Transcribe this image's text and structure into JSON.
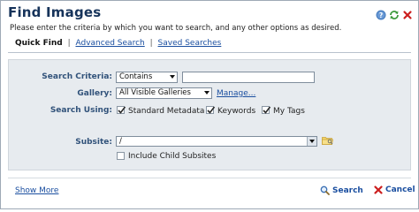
{
  "dialog": {
    "title": "Find Images",
    "instructions": "Please enter the criteria by which you want to search, and any other options as desired."
  },
  "header_icons": [
    "help-icon",
    "refresh-icon",
    "close-icon"
  ],
  "tabs": {
    "quick_find": "Quick Find",
    "advanced_search": "Advanced Search",
    "saved_searches": "Saved Searches",
    "separator": "|"
  },
  "form": {
    "search_criteria_label": "Search Criteria:",
    "criteria_operator": "Contains",
    "criteria_text": "",
    "gallery_label": "Gallery:",
    "gallery_value": "All Visible Galleries",
    "manage_link": "Manage...",
    "search_using_label": "Search Using:",
    "search_using_options": [
      {
        "label": "Standard Metadata",
        "checked": true
      },
      {
        "label": "Keywords",
        "checked": true
      },
      {
        "label": "My Tags",
        "checked": true
      }
    ],
    "subsite_label": "Subsite:",
    "subsite_value": "/",
    "include_child_subsites_label": "Include Child Subsites",
    "include_child_subsites_checked": false
  },
  "footer": {
    "show_more": "Show More",
    "search_button": "Search",
    "cancel_button": "Cancel"
  },
  "colors": {
    "title": "#16335a",
    "label": "#31527a",
    "link": "#1b4fa0",
    "panel_bg": "#e7ebef",
    "cancel_icon": "#cc1f1f"
  }
}
